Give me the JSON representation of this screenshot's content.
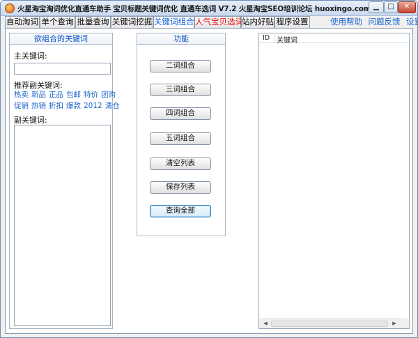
{
  "window": {
    "title": "火星淘宝淘词优化直通车助手 宝贝标题关键词优化 直通车选词 V7.2 火星淘宝SEO培训论坛 huoxingo.com",
    "min_glyph": "▁",
    "max_glyph": "□",
    "close_glyph": "✕"
  },
  "tabs": [
    {
      "label": "自动淘词"
    },
    {
      "label": "单个查询"
    },
    {
      "label": "批量查询"
    },
    {
      "label": "关键词挖掘"
    },
    {
      "label": "关键词组合",
      "active": true
    },
    {
      "label": "人气宝贝选词",
      "color": "#e8100c"
    },
    {
      "label": "站内好贴"
    },
    {
      "label": "程序设置"
    }
  ],
  "top_links": {
    "help": "使用帮助",
    "feedback": "问题反馈",
    "settings": "设置"
  },
  "left_panel": {
    "title": "欲组合的关键词",
    "main_keyword_label": "主关键词:",
    "main_keyword_value": "",
    "recommended_label": "推荐副关键词:",
    "recommended_keywords_row1": [
      "热卖",
      "新品",
      "正品",
      "包邮",
      "特价",
      "团购"
    ],
    "recommended_keywords_row2": [
      "促销",
      "热销",
      "折扣",
      "爆款",
      "2012",
      "清仓"
    ],
    "sub_keyword_label": "副关键词:",
    "sub_keyword_value": ""
  },
  "function_panel": {
    "title": "功能",
    "buttons": {
      "two_word": "二词组合",
      "three_word": "三词组合",
      "four_word": "四词组合",
      "five_word": "五词组合",
      "clear_list": "清空列表",
      "save_list": "保存列表",
      "query_all": "查询全部"
    }
  },
  "result_list": {
    "columns": {
      "id": "ID",
      "keyword": "关键词"
    },
    "rows": []
  },
  "colors": {
    "accent": "#1f66cc",
    "hot_tab": "#e8100c",
    "panel_title": "#0b57c8"
  }
}
